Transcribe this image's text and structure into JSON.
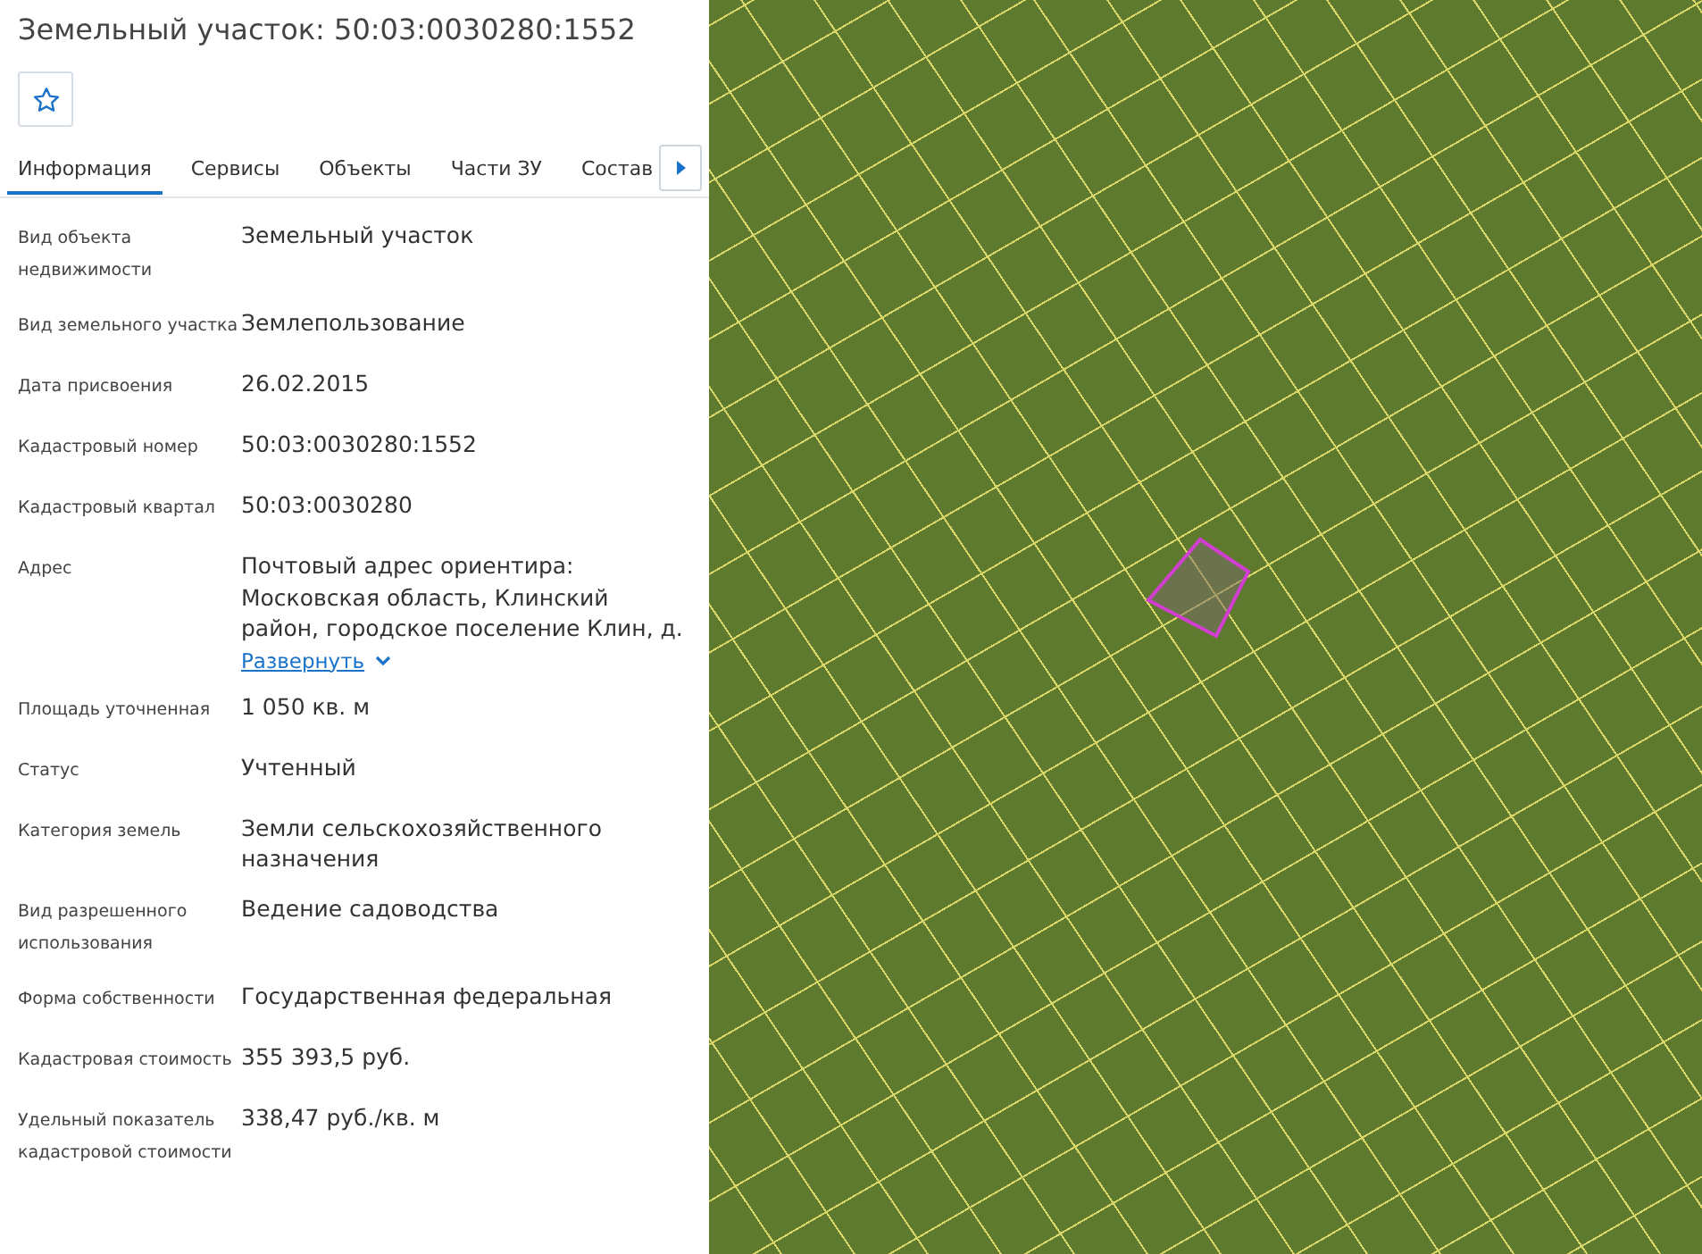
{
  "title": "Земельный участок: 50:03:0030280:1552",
  "favorite": {
    "selected": false
  },
  "tabs": [
    {
      "label": "Информация",
      "selected": true
    },
    {
      "label": "Сервисы",
      "selected": false
    },
    {
      "label": "Объекты",
      "selected": false
    },
    {
      "label": "Части ЗУ",
      "selected": false
    },
    {
      "label": "Состав",
      "selected": false
    }
  ],
  "fields": [
    {
      "label": "Вид объекта недвижимости",
      "value": "Земельный участок"
    },
    {
      "label": "Вид земельного участка",
      "value": "Землепользование"
    },
    {
      "label": "Дата присвоения",
      "value": "26.02.2015"
    },
    {
      "label": "Кадастровый номер",
      "value": "50:03:0030280:1552"
    },
    {
      "label": "Кадастровый квартал",
      "value": "50:03:0030280"
    },
    {
      "label": "Адрес",
      "value": "Почтовый адрес ориентира: Московская область, Клинский район, городское поселение Клин, д.",
      "expand_label": "Развернуть"
    },
    {
      "label": "Площадь уточненная",
      "value": "1 050 кв. м"
    },
    {
      "label": "Статус",
      "value": "Учтенный"
    },
    {
      "label": "Категория земель",
      "value": "Земли сельскохозяйственного назначения"
    },
    {
      "label": "Вид разрешенного использования",
      "value": "Ведение садоводства"
    },
    {
      "label": "Форма собственности",
      "value": "Государственная федеральная"
    },
    {
      "label": "Кадастровая стоимость",
      "value": "355 393,5 руб."
    },
    {
      "label": "Удельный показатель кадастровой стоимости",
      "value": "338,47 руб./кв. м"
    }
  ]
}
